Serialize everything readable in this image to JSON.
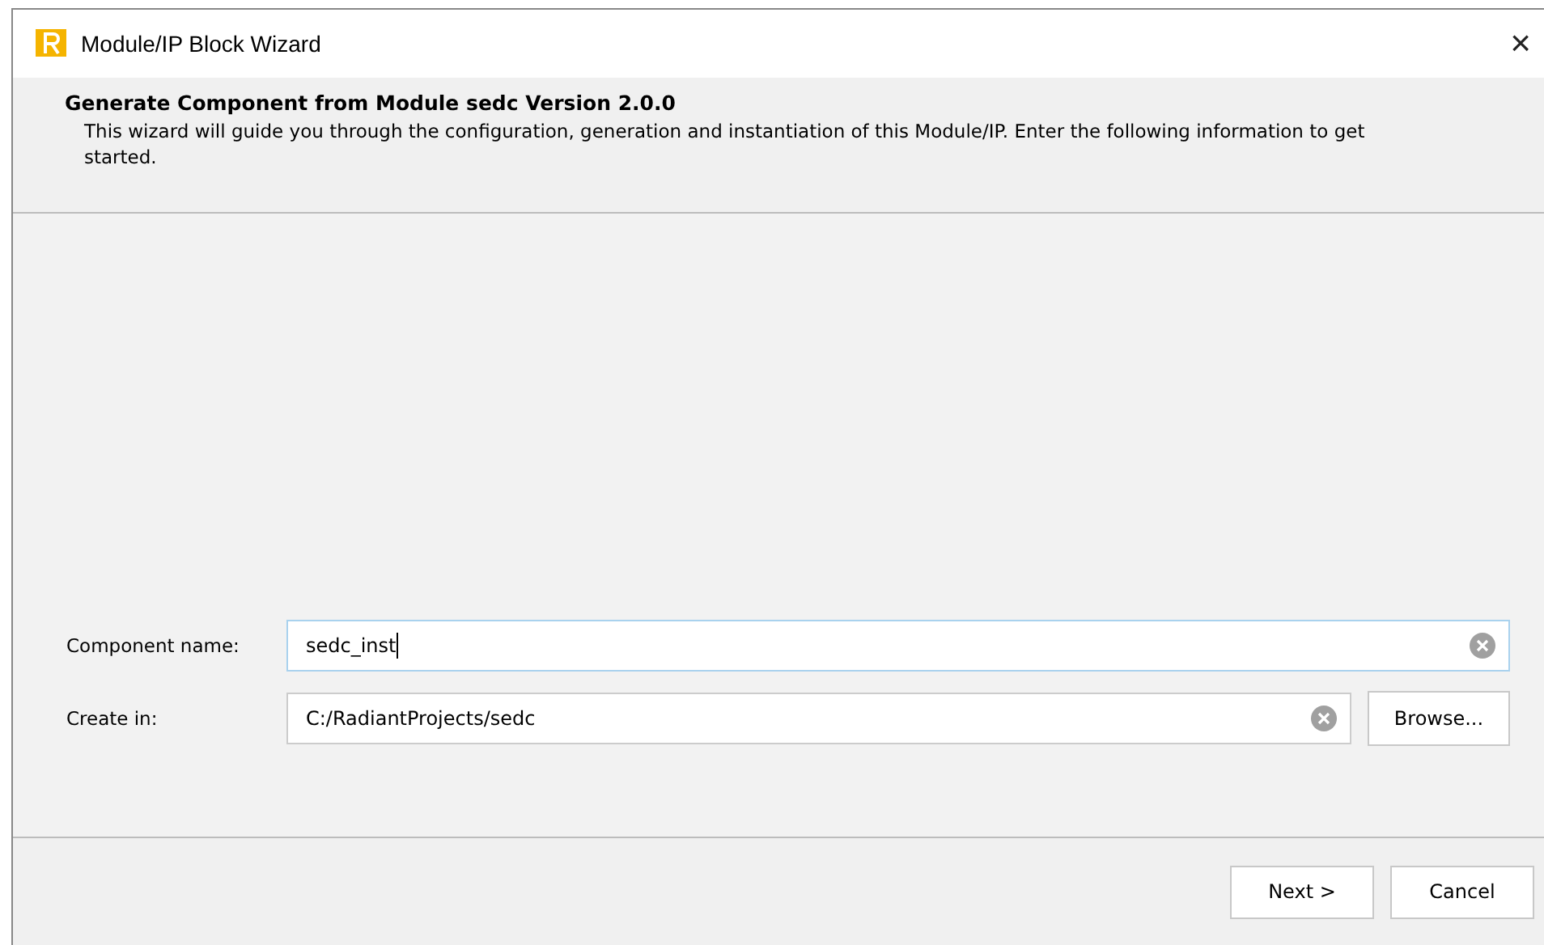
{
  "window": {
    "title": "Module/IP Block Wizard",
    "close": "×"
  },
  "header": {
    "title": "Generate Component from Module sedc Version 2.0.0",
    "description": "This wizard will guide you through the configuration, generation and instantiation of this Module/IP. Enter the following information to get started."
  },
  "fields": [
    {
      "label": "Component name:",
      "value": "sedc_inst",
      "focused": true
    },
    {
      "label": "Create in:",
      "value": "C:/RadiantProjects/sedc",
      "focused": false,
      "button": "Browse..."
    }
  ],
  "buttons": [
    "Next >",
    "Cancel"
  ]
}
